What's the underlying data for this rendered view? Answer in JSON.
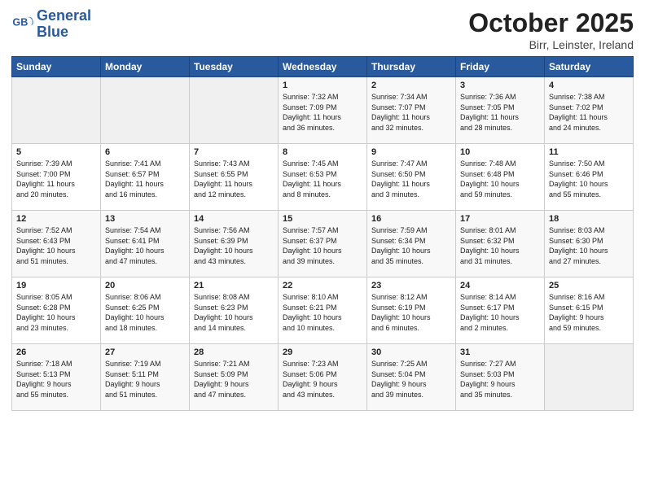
{
  "header": {
    "logo_line1": "General",
    "logo_line2": "Blue",
    "title": "October 2025",
    "subtitle": "Birr, Leinster, Ireland"
  },
  "weekdays": [
    "Sunday",
    "Monday",
    "Tuesday",
    "Wednesday",
    "Thursday",
    "Friday",
    "Saturday"
  ],
  "weeks": [
    [
      {
        "day": "",
        "info": ""
      },
      {
        "day": "",
        "info": ""
      },
      {
        "day": "",
        "info": ""
      },
      {
        "day": "1",
        "info": "Sunrise: 7:32 AM\nSunset: 7:09 PM\nDaylight: 11 hours\nand 36 minutes."
      },
      {
        "day": "2",
        "info": "Sunrise: 7:34 AM\nSunset: 7:07 PM\nDaylight: 11 hours\nand 32 minutes."
      },
      {
        "day": "3",
        "info": "Sunrise: 7:36 AM\nSunset: 7:05 PM\nDaylight: 11 hours\nand 28 minutes."
      },
      {
        "day": "4",
        "info": "Sunrise: 7:38 AM\nSunset: 7:02 PM\nDaylight: 11 hours\nand 24 minutes."
      }
    ],
    [
      {
        "day": "5",
        "info": "Sunrise: 7:39 AM\nSunset: 7:00 PM\nDaylight: 11 hours\nand 20 minutes."
      },
      {
        "day": "6",
        "info": "Sunrise: 7:41 AM\nSunset: 6:57 PM\nDaylight: 11 hours\nand 16 minutes."
      },
      {
        "day": "7",
        "info": "Sunrise: 7:43 AM\nSunset: 6:55 PM\nDaylight: 11 hours\nand 12 minutes."
      },
      {
        "day": "8",
        "info": "Sunrise: 7:45 AM\nSunset: 6:53 PM\nDaylight: 11 hours\nand 8 minutes."
      },
      {
        "day": "9",
        "info": "Sunrise: 7:47 AM\nSunset: 6:50 PM\nDaylight: 11 hours\nand 3 minutes."
      },
      {
        "day": "10",
        "info": "Sunrise: 7:48 AM\nSunset: 6:48 PM\nDaylight: 10 hours\nand 59 minutes."
      },
      {
        "day": "11",
        "info": "Sunrise: 7:50 AM\nSunset: 6:46 PM\nDaylight: 10 hours\nand 55 minutes."
      }
    ],
    [
      {
        "day": "12",
        "info": "Sunrise: 7:52 AM\nSunset: 6:43 PM\nDaylight: 10 hours\nand 51 minutes."
      },
      {
        "day": "13",
        "info": "Sunrise: 7:54 AM\nSunset: 6:41 PM\nDaylight: 10 hours\nand 47 minutes."
      },
      {
        "day": "14",
        "info": "Sunrise: 7:56 AM\nSunset: 6:39 PM\nDaylight: 10 hours\nand 43 minutes."
      },
      {
        "day": "15",
        "info": "Sunrise: 7:57 AM\nSunset: 6:37 PM\nDaylight: 10 hours\nand 39 minutes."
      },
      {
        "day": "16",
        "info": "Sunrise: 7:59 AM\nSunset: 6:34 PM\nDaylight: 10 hours\nand 35 minutes."
      },
      {
        "day": "17",
        "info": "Sunrise: 8:01 AM\nSunset: 6:32 PM\nDaylight: 10 hours\nand 31 minutes."
      },
      {
        "day": "18",
        "info": "Sunrise: 8:03 AM\nSunset: 6:30 PM\nDaylight: 10 hours\nand 27 minutes."
      }
    ],
    [
      {
        "day": "19",
        "info": "Sunrise: 8:05 AM\nSunset: 6:28 PM\nDaylight: 10 hours\nand 23 minutes."
      },
      {
        "day": "20",
        "info": "Sunrise: 8:06 AM\nSunset: 6:25 PM\nDaylight: 10 hours\nand 18 minutes."
      },
      {
        "day": "21",
        "info": "Sunrise: 8:08 AM\nSunset: 6:23 PM\nDaylight: 10 hours\nand 14 minutes."
      },
      {
        "day": "22",
        "info": "Sunrise: 8:10 AM\nSunset: 6:21 PM\nDaylight: 10 hours\nand 10 minutes."
      },
      {
        "day": "23",
        "info": "Sunrise: 8:12 AM\nSunset: 6:19 PM\nDaylight: 10 hours\nand 6 minutes."
      },
      {
        "day": "24",
        "info": "Sunrise: 8:14 AM\nSunset: 6:17 PM\nDaylight: 10 hours\nand 2 minutes."
      },
      {
        "day": "25",
        "info": "Sunrise: 8:16 AM\nSunset: 6:15 PM\nDaylight: 9 hours\nand 59 minutes."
      }
    ],
    [
      {
        "day": "26",
        "info": "Sunrise: 7:18 AM\nSunset: 5:13 PM\nDaylight: 9 hours\nand 55 minutes."
      },
      {
        "day": "27",
        "info": "Sunrise: 7:19 AM\nSunset: 5:11 PM\nDaylight: 9 hours\nand 51 minutes."
      },
      {
        "day": "28",
        "info": "Sunrise: 7:21 AM\nSunset: 5:09 PM\nDaylight: 9 hours\nand 47 minutes."
      },
      {
        "day": "29",
        "info": "Sunrise: 7:23 AM\nSunset: 5:06 PM\nDaylight: 9 hours\nand 43 minutes."
      },
      {
        "day": "30",
        "info": "Sunrise: 7:25 AM\nSunset: 5:04 PM\nDaylight: 9 hours\nand 39 minutes."
      },
      {
        "day": "31",
        "info": "Sunrise: 7:27 AM\nSunset: 5:03 PM\nDaylight: 9 hours\nand 35 minutes."
      },
      {
        "day": "",
        "info": ""
      }
    ]
  ]
}
